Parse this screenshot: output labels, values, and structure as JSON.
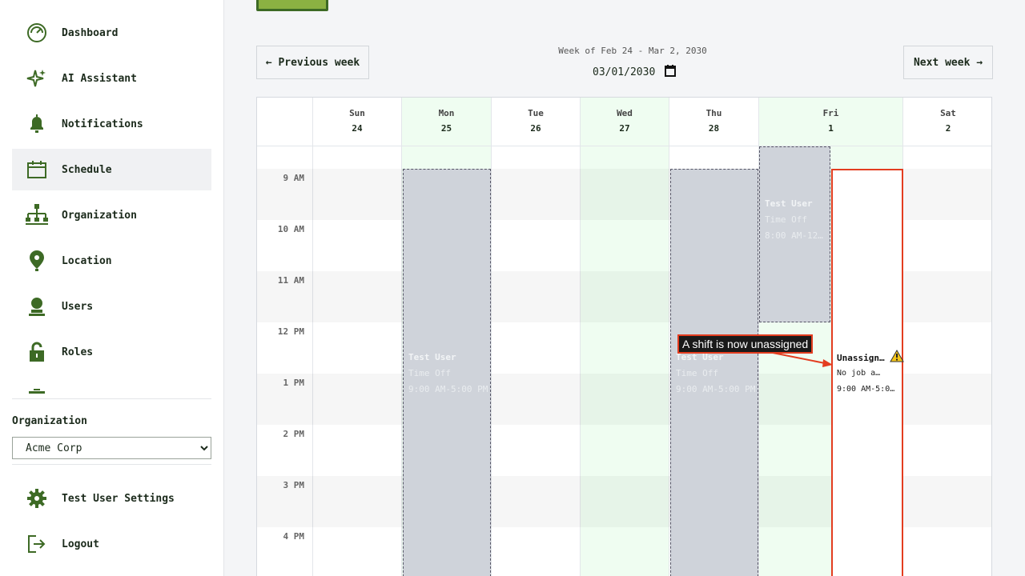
{
  "sidebar": {
    "items": [
      {
        "label": "Dashboard",
        "icon": "dashboard-icon"
      },
      {
        "label": "AI Assistant",
        "icon": "sparkle-icon"
      },
      {
        "label": "Notifications",
        "icon": "bell-icon"
      },
      {
        "label": "Schedule",
        "icon": "calendar-icon",
        "active": true
      },
      {
        "label": "Organization",
        "icon": "org-chart-icon"
      },
      {
        "label": "Location",
        "icon": "map-pin-icon"
      },
      {
        "label": "Users",
        "icon": "user-icon"
      },
      {
        "label": "Roles",
        "icon": "lock-icon"
      }
    ],
    "org_label": "Organization",
    "org_selected": "Acme Corp",
    "settings_label": "Test User Settings",
    "logout_label": "Logout"
  },
  "toolbar": {
    "prev_label": "← Previous week",
    "next_label": "Next week →",
    "week_label": "Week of Feb 24 - Mar 2, 2030",
    "date_value": "03/01/2030"
  },
  "calendar": {
    "days": [
      {
        "name": "Sun",
        "date": "24"
      },
      {
        "name": "Mon",
        "date": "25"
      },
      {
        "name": "Tue",
        "date": "26"
      },
      {
        "name": "Wed",
        "date": "27"
      },
      {
        "name": "Thu",
        "date": "28"
      },
      {
        "name": "Fri",
        "date": "1"
      },
      {
        "name": "Sat",
        "date": "2"
      }
    ],
    "hours": [
      "9 AM",
      "10 AM",
      "11 AM",
      "12 PM",
      "1 PM",
      "2 PM",
      "3 PM",
      "4 PM"
    ],
    "events": {
      "mon": {
        "name": "Test User",
        "type": "Time Off",
        "time": "9:00 AM-5:00 PM"
      },
      "thu": {
        "name": "Test User",
        "type": "Time Off",
        "time": "9:00 AM-5:00 PM"
      },
      "fri": {
        "name": "Test User",
        "type": "Time Off",
        "time": "8:00 AM-12:…"
      },
      "unassigned": {
        "name": "Unassign…",
        "job": "No job a…",
        "time": "9:00 AM-5:0…"
      }
    }
  },
  "annotation": {
    "text": "A shift is now unassigned"
  },
  "colors": {
    "accent": "#3d6a25",
    "highlight": "#effdf1",
    "alert": "#e33d20",
    "warning": "#f5c518"
  }
}
